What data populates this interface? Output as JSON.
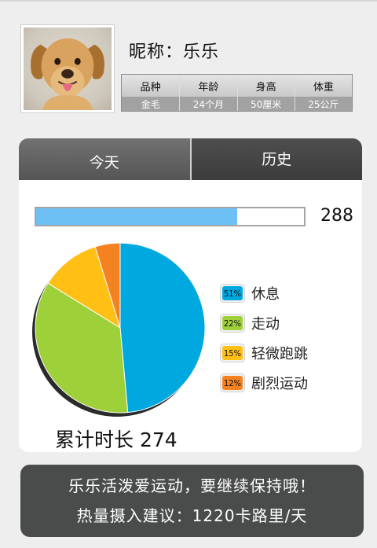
{
  "profile": {
    "nickname": "昵称：乐乐",
    "stats": [
      {
        "label": "品种",
        "value": "金毛"
      },
      {
        "label": "年龄",
        "value": "24个月"
      },
      {
        "label": "身高",
        "value": "50厘米"
      },
      {
        "label": "体重",
        "value": "25公斤"
      }
    ]
  },
  "tabs": {
    "today": "今天",
    "history": "历史"
  },
  "progress": {
    "value": "288",
    "fill_fraction": 0.75,
    "color": "#6cc0f4"
  },
  "chart_data": {
    "type": "pie",
    "slices": [
      {
        "label": "休息",
        "percent_label": "51%",
        "value": 51,
        "color": "#00a8e0"
      },
      {
        "label": "走动",
        "percent_label": "22%",
        "value": 37,
        "color": "#9ed03a"
      },
      {
        "label": "轻微跑跳",
        "percent_label": "15%",
        "value": 12,
        "color": "#ffbf14"
      },
      {
        "label": "剧烈运动",
        "percent_label": "12%",
        "value": 5,
        "color": "#f58220"
      }
    ]
  },
  "total": {
    "text": "累计时长 274"
  },
  "footer": {
    "line1": "乐乐活泼爱运动，要继续保持哦！",
    "line2": "热量摄入建议：1220卡路里/天"
  }
}
